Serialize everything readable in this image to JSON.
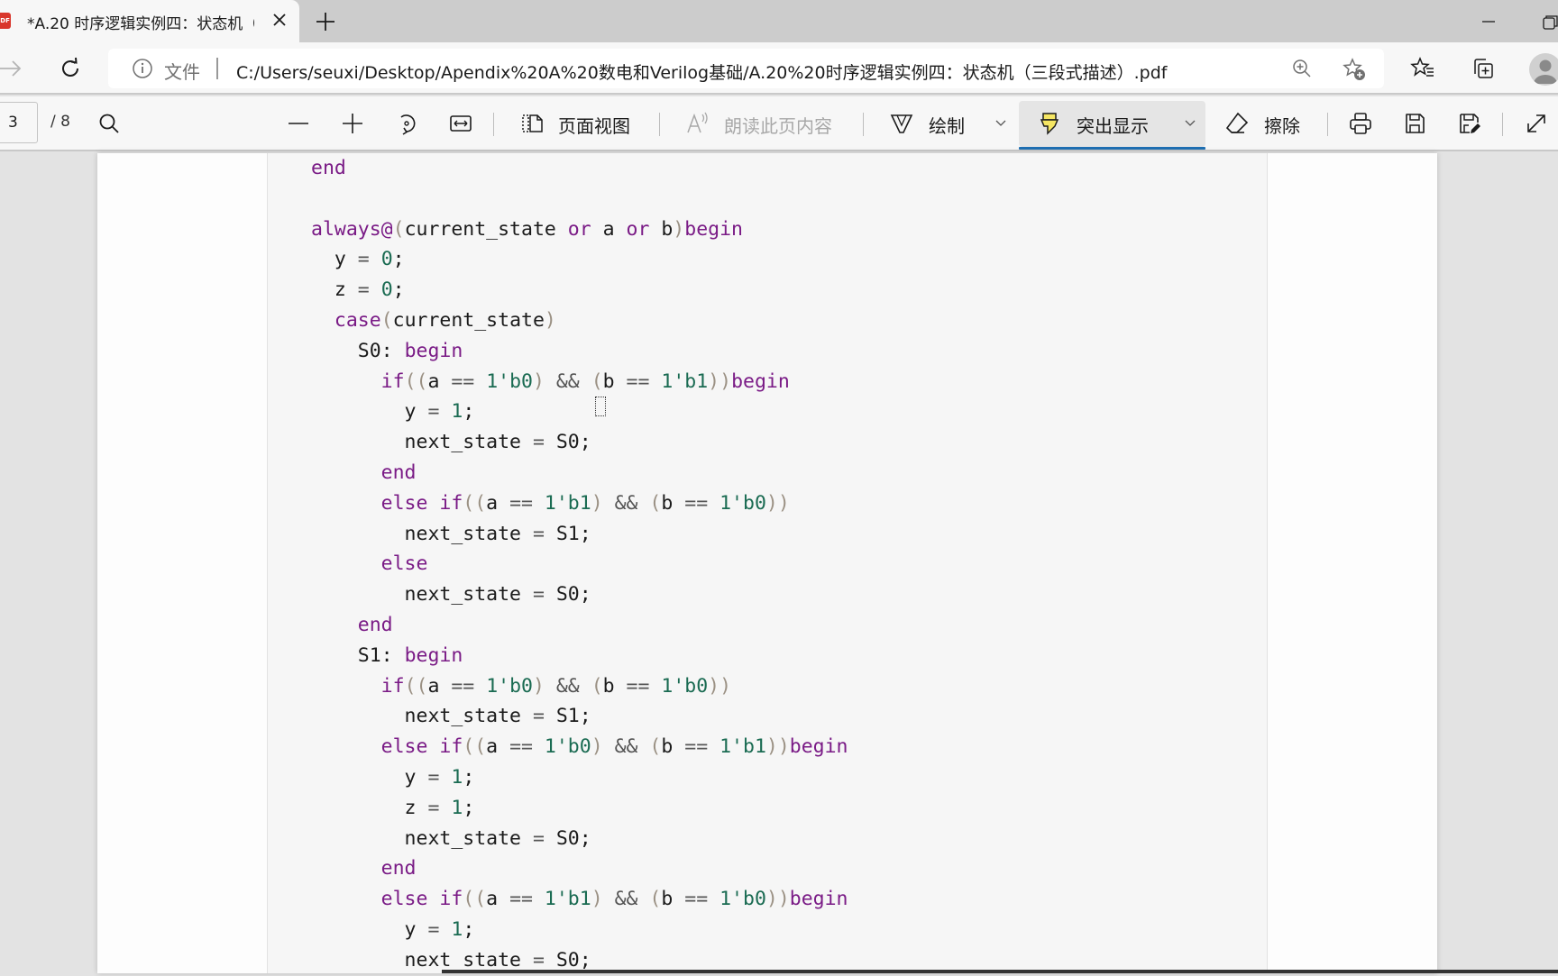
{
  "browser": {
    "tab": {
      "title": "*A.20 时序逻辑实例四：状态机（",
      "file_badge": "PDF",
      "close_label": "×"
    },
    "new_tab_label": "+",
    "address_bar": {
      "protocol_label": "文件",
      "url": "C:/Users/seuxi/Desktop/Apendix%20A%20数电和Verilog基础/A.20%20时序逻辑实例四：状态机（三段式描述）.pdf"
    },
    "icons": {
      "forward": "arrow-right-icon",
      "reload": "reload-icon",
      "info": "info-icon",
      "zoom": "zoom-icon",
      "add_favorite": "star-add-icon",
      "favorites": "favorites-icon",
      "collections": "collections-icon",
      "profile": "avatar-icon"
    }
  },
  "pdf_toolbar": {
    "current_page": "3",
    "page_count": "/ 8",
    "page_view_label": "页面视图",
    "read_aloud_label": "朗读此页内容",
    "draw_label": "绘制",
    "highlight_label": "突出显示",
    "erase_label": "擦除",
    "highlight_color": "#f5e663",
    "active_underline_color": "#1f6fb2"
  },
  "document": {
    "code_lines": [
      [
        {
          "t": "end",
          "c": "kw"
        }
      ],
      [],
      [
        {
          "t": "always@",
          "c": "kw"
        },
        {
          "t": "(",
          "c": "paren"
        },
        {
          "t": "current_state "
        },
        {
          "t": "or",
          "c": "kw"
        },
        {
          "t": " a "
        },
        {
          "t": "or",
          "c": "kw"
        },
        {
          "t": " b"
        },
        {
          "t": ")",
          "c": "paren"
        },
        {
          "t": "begin",
          "c": "kw"
        }
      ],
      [
        {
          "t": "  y "
        },
        {
          "t": "=",
          "c": "op"
        },
        {
          "t": " "
        },
        {
          "t": "0",
          "c": "num"
        },
        {
          "t": ";"
        }
      ],
      [
        {
          "t": "  z "
        },
        {
          "t": "=",
          "c": "op"
        },
        {
          "t": " "
        },
        {
          "t": "0",
          "c": "num"
        },
        {
          "t": ";"
        }
      ],
      [
        {
          "t": "  "
        },
        {
          "t": "case",
          "c": "kw"
        },
        {
          "t": "(",
          "c": "paren"
        },
        {
          "t": "current_state"
        },
        {
          "t": ")",
          "c": "paren"
        }
      ],
      [
        {
          "t": "    S0: "
        },
        {
          "t": "begin",
          "c": "kw"
        }
      ],
      [
        {
          "t": "      "
        },
        {
          "t": "if",
          "c": "kw"
        },
        {
          "t": "((",
          "c": "paren"
        },
        {
          "t": "a "
        },
        {
          "t": "==",
          "c": "op"
        },
        {
          "t": " "
        },
        {
          "t": "1'b0",
          "c": "num"
        },
        {
          "t": ")",
          "c": "paren"
        },
        {
          "t": " && ",
          "c": "op"
        },
        {
          "t": "(",
          "c": "paren"
        },
        {
          "t": "b "
        },
        {
          "t": "==",
          "c": "op"
        },
        {
          "t": " "
        },
        {
          "t": "1'b1",
          "c": "num"
        },
        {
          "t": "))",
          "c": "paren"
        },
        {
          "t": "begin",
          "c": "kw"
        }
      ],
      [
        {
          "t": "        y "
        },
        {
          "t": "=",
          "c": "op"
        },
        {
          "t": " "
        },
        {
          "t": "1",
          "c": "num"
        },
        {
          "t": ";"
        }
      ],
      [
        {
          "t": "        next_state "
        },
        {
          "t": "=",
          "c": "op"
        },
        {
          "t": " S0;"
        }
      ],
      [
        {
          "t": "      "
        },
        {
          "t": "end",
          "c": "kw"
        }
      ],
      [
        {
          "t": "      "
        },
        {
          "t": "else if",
          "c": "kw"
        },
        {
          "t": "((",
          "c": "paren"
        },
        {
          "t": "a "
        },
        {
          "t": "==",
          "c": "op"
        },
        {
          "t": " "
        },
        {
          "t": "1'b1",
          "c": "num"
        },
        {
          "t": ")",
          "c": "paren"
        },
        {
          "t": " && ",
          "c": "op"
        },
        {
          "t": "(",
          "c": "paren"
        },
        {
          "t": "b "
        },
        {
          "t": "==",
          "c": "op"
        },
        {
          "t": " "
        },
        {
          "t": "1'b0",
          "c": "num"
        },
        {
          "t": "))",
          "c": "paren"
        }
      ],
      [
        {
          "t": "        next_state "
        },
        {
          "t": "=",
          "c": "op"
        },
        {
          "t": " S1;"
        }
      ],
      [
        {
          "t": "      "
        },
        {
          "t": "else",
          "c": "kw"
        }
      ],
      [
        {
          "t": "        next_state "
        },
        {
          "t": "=",
          "c": "op"
        },
        {
          "t": " S0;"
        }
      ],
      [
        {
          "t": "    "
        },
        {
          "t": "end",
          "c": "kw"
        }
      ],
      [
        {
          "t": "    S1: "
        },
        {
          "t": "begin",
          "c": "kw"
        }
      ],
      [
        {
          "t": "      "
        },
        {
          "t": "if",
          "c": "kw"
        },
        {
          "t": "((",
          "c": "paren"
        },
        {
          "t": "a "
        },
        {
          "t": "==",
          "c": "op"
        },
        {
          "t": " "
        },
        {
          "t": "1'b0",
          "c": "num"
        },
        {
          "t": ")",
          "c": "paren"
        },
        {
          "t": " && ",
          "c": "op"
        },
        {
          "t": "(",
          "c": "paren"
        },
        {
          "t": "b "
        },
        {
          "t": "==",
          "c": "op"
        },
        {
          "t": " "
        },
        {
          "t": "1'b0",
          "c": "num"
        },
        {
          "t": "))",
          "c": "paren"
        }
      ],
      [
        {
          "t": "        next_state "
        },
        {
          "t": "=",
          "c": "op"
        },
        {
          "t": " S1;"
        }
      ],
      [
        {
          "t": "      "
        },
        {
          "t": "else if",
          "c": "kw"
        },
        {
          "t": "((",
          "c": "paren"
        },
        {
          "t": "a "
        },
        {
          "t": "==",
          "c": "op"
        },
        {
          "t": " "
        },
        {
          "t": "1'b0",
          "c": "num"
        },
        {
          "t": ")",
          "c": "paren"
        },
        {
          "t": " && ",
          "c": "op"
        },
        {
          "t": "(",
          "c": "paren"
        },
        {
          "t": "b "
        },
        {
          "t": "==",
          "c": "op"
        },
        {
          "t": " "
        },
        {
          "t": "1'b1",
          "c": "num"
        },
        {
          "t": "))",
          "c": "paren"
        },
        {
          "t": "begin",
          "c": "kw"
        }
      ],
      [
        {
          "t": "        y "
        },
        {
          "t": "=",
          "c": "op"
        },
        {
          "t": " "
        },
        {
          "t": "1",
          "c": "num"
        },
        {
          "t": ";"
        }
      ],
      [
        {
          "t": "        z "
        },
        {
          "t": "=",
          "c": "op"
        },
        {
          "t": " "
        },
        {
          "t": "1",
          "c": "num"
        },
        {
          "t": ";"
        }
      ],
      [
        {
          "t": "        next_state "
        },
        {
          "t": "=",
          "c": "op"
        },
        {
          "t": " S0;"
        }
      ],
      [
        {
          "t": "      "
        },
        {
          "t": "end",
          "c": "kw"
        }
      ],
      [
        {
          "t": "      "
        },
        {
          "t": "else if",
          "c": "kw"
        },
        {
          "t": "((",
          "c": "paren"
        },
        {
          "t": "a "
        },
        {
          "t": "==",
          "c": "op"
        },
        {
          "t": " "
        },
        {
          "t": "1'b1",
          "c": "num"
        },
        {
          "t": ")",
          "c": "paren"
        },
        {
          "t": " && ",
          "c": "op"
        },
        {
          "t": "(",
          "c": "paren"
        },
        {
          "t": "b "
        },
        {
          "t": "==",
          "c": "op"
        },
        {
          "t": " "
        },
        {
          "t": "1'b0",
          "c": "num"
        },
        {
          "t": "))",
          "c": "paren"
        },
        {
          "t": "begin",
          "c": "kw"
        }
      ],
      [
        {
          "t": "        y "
        },
        {
          "t": "=",
          "c": "op"
        },
        {
          "t": " "
        },
        {
          "t": "1",
          "c": "num"
        },
        {
          "t": ";"
        }
      ],
      [
        {
          "t": "        next_state "
        },
        {
          "t": "=",
          "c": "op"
        },
        {
          "t": " S0;"
        }
      ]
    ],
    "syntax_colors": {
      "keyword": "#7a1b86",
      "number": "#1a6b52",
      "paren": "#9b9184",
      "text": "#1b1b1b"
    }
  }
}
